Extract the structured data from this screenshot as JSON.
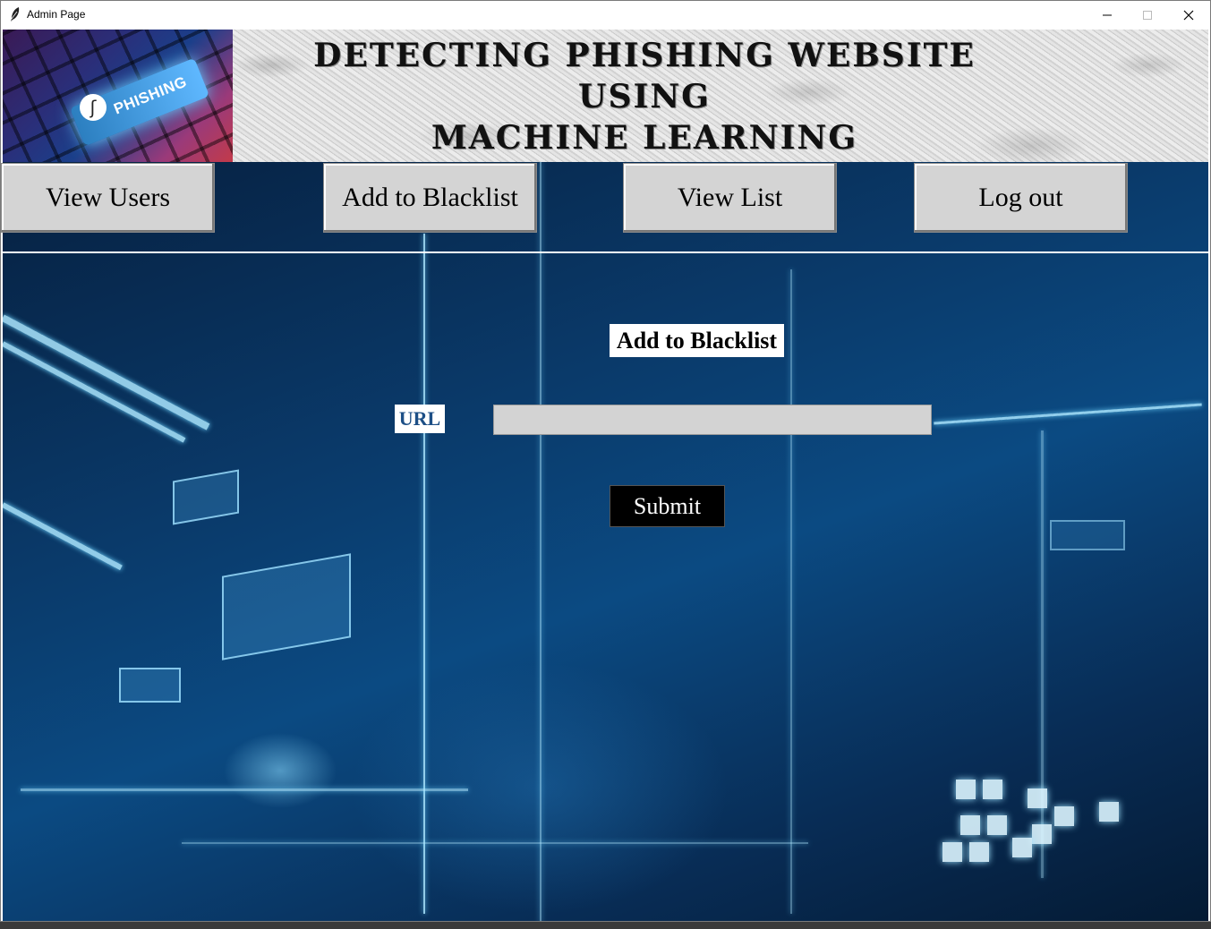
{
  "window": {
    "title": "Admin Page"
  },
  "header": {
    "logo_text": "PHISHING",
    "title_lines": [
      "DETECTING PHISHING WEBSITE",
      "USING",
      "MACHINE LEARNING"
    ]
  },
  "nav": {
    "view_users": "View Users",
    "add_blacklist": "Add to Blacklist",
    "view_list": "View List",
    "logout": "Log out"
  },
  "form": {
    "title": "Add to Blacklist",
    "url_label": "URL",
    "url_value": "",
    "submit_label": "Submit"
  },
  "colors": {
    "button_bg": "#d4d4d4",
    "submit_bg": "#000000",
    "url_label_color": "#1d4f86",
    "input_bg": "#d3d3d3"
  },
  "icons": {
    "app": "feather-icon",
    "minimize": "minimize-icon",
    "maximize": "maximize-icon",
    "close": "close-icon"
  }
}
